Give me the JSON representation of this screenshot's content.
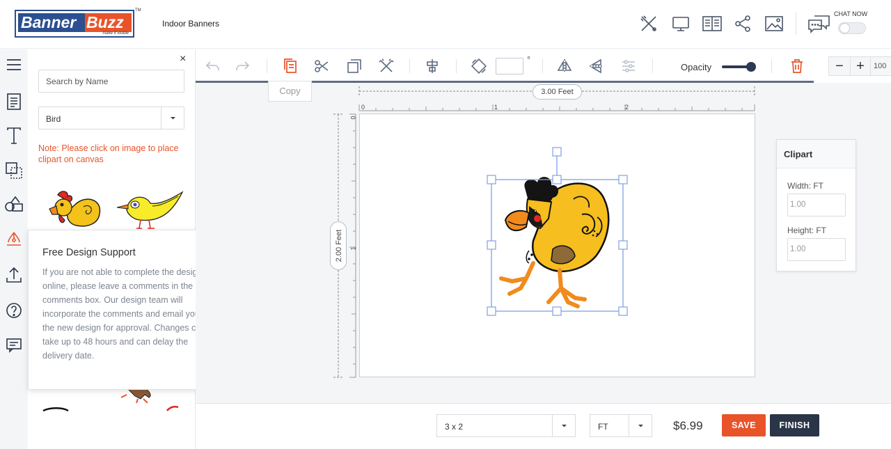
{
  "header": {
    "logo_word1": "Banner",
    "logo_word2": "Buzz",
    "logo_tagline": "make it visible",
    "logo_tm": "TM",
    "title": "Indoor Banners",
    "chat_label": "CHAT NOW",
    "chat_enabled": false,
    "icons": [
      "design-tools-icon",
      "monitor-preview-icon",
      "book-reader-icon",
      "share-icon",
      "image-icon",
      "chat-bubble-icon"
    ]
  },
  "rail": {
    "icons": [
      "menu-icon",
      "document-icon",
      "text-icon",
      "shapes-icon",
      "clipart-icon",
      "clipart-active-icon",
      "upload-icon",
      "help-icon",
      "comments-icon"
    ],
    "active": "clipart-active-icon"
  },
  "panel": {
    "close_glyph": "×",
    "search_placeholder": "Search by Name",
    "category_value": "Bird",
    "note": "Note: Please click on image to place clipart on canvas"
  },
  "support": {
    "title": "Free Design Support",
    "close_glyph": "×",
    "body": "If you are not able to complete the design online, please leave a comments in the comments box. Our design team will incorporate the comments and email you the new design for approval. Changes can take up to 48 hours and can delay the delivery date."
  },
  "toolbar": {
    "copy_tooltip": "Copy",
    "degree_symbol": "°",
    "opacity_label": "Opacity",
    "opacity_value": 1.0,
    "zoom_minus": "−",
    "zoom_plus": "+",
    "zoom_value": "100"
  },
  "canvas": {
    "width_label": "3.00 Feet",
    "height_label": "2.00 Feet",
    "ruler_x": [
      "0",
      "1",
      "2"
    ],
    "ruler_y": [
      "0",
      "1"
    ]
  },
  "props": {
    "title": "Clipart",
    "width_label": "Width: FT",
    "width_value": "1.00",
    "height_label": "Height: FT",
    "height_value": "1.00"
  },
  "footer": {
    "size_value": "3 x 2",
    "unit_value": "FT",
    "price": "$6.99",
    "save_label": "SAVE",
    "finish_label": "FINISH"
  },
  "colors": {
    "brand_blue": "#2b4f91",
    "brand_orange": "#e8532a",
    "dark": "#2b3548"
  }
}
